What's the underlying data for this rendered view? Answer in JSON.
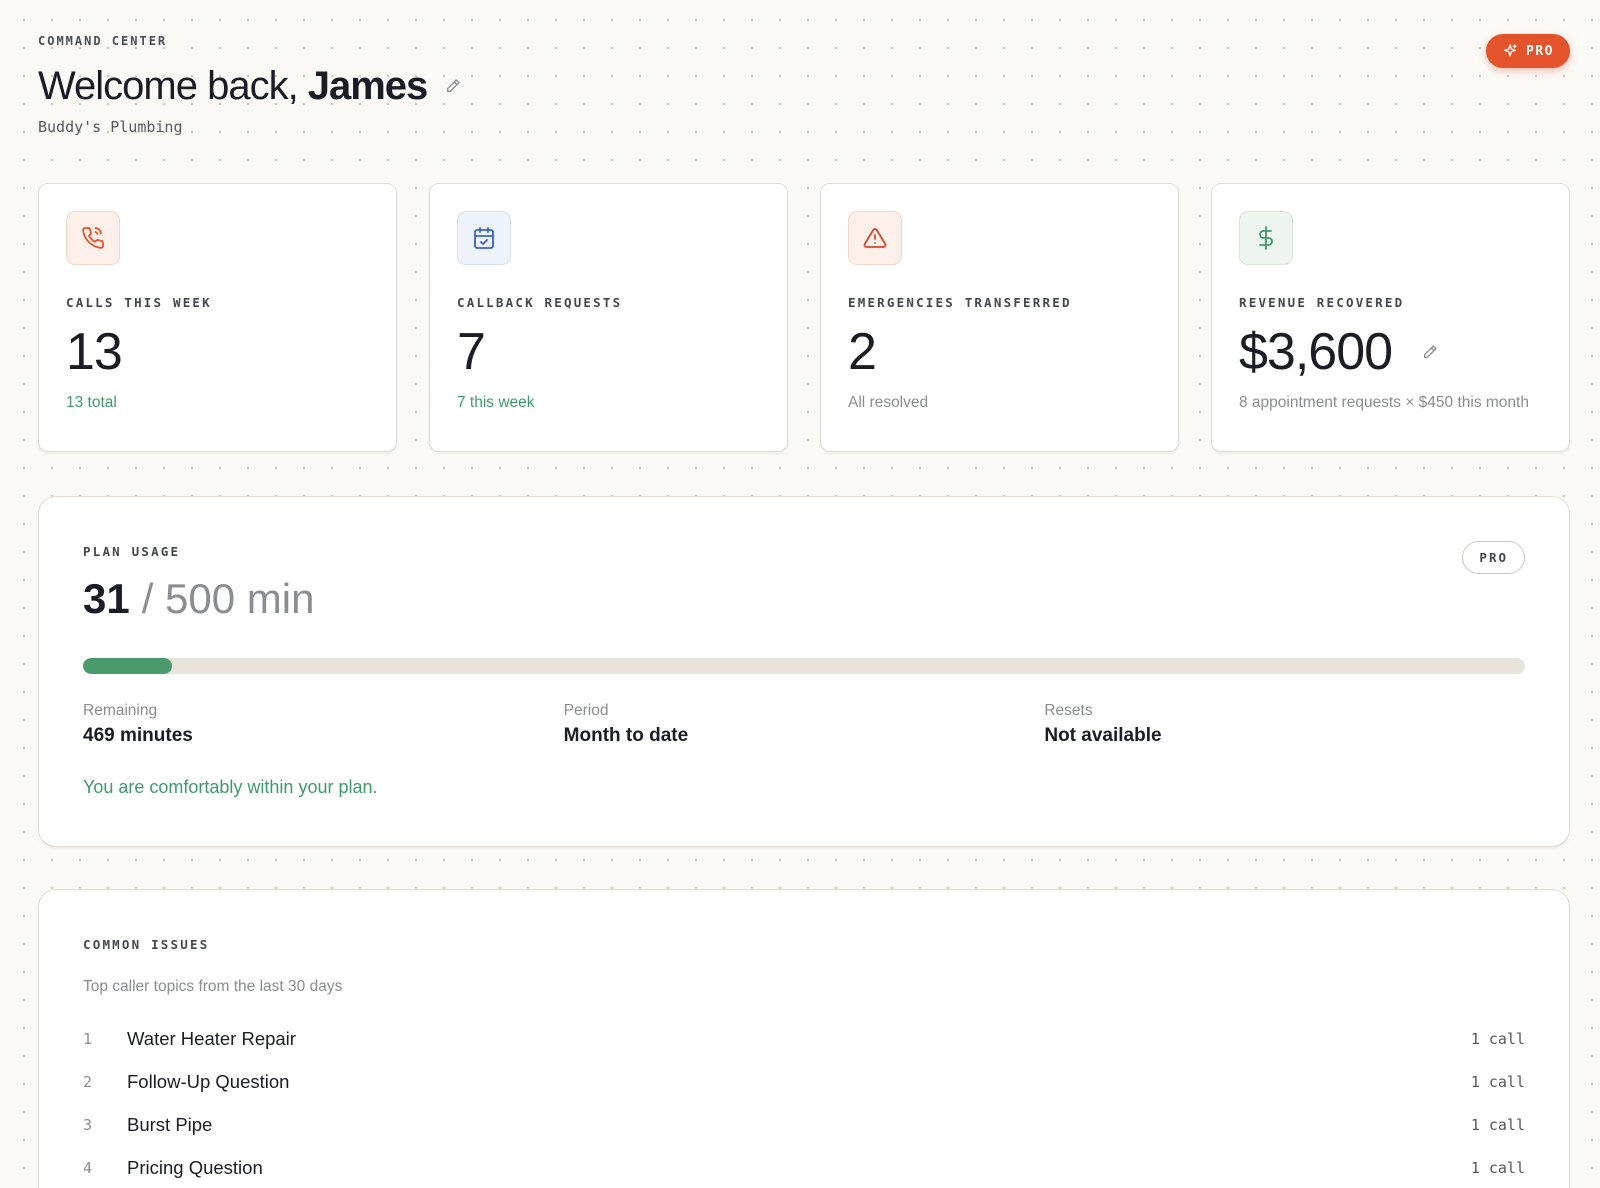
{
  "header": {
    "eyebrow": "COMMAND CENTER",
    "welcome_prefix": "Welcome back,",
    "user_name": "James",
    "company": "Buddy's Plumbing",
    "pro_button_label": "PRO"
  },
  "cards": [
    {
      "icon": "phone-icon",
      "label": "CALLS THIS WEEK",
      "value": "13",
      "sub": "13 total"
    },
    {
      "icon": "calendar-check-icon",
      "label": "CALLBACK REQUESTS",
      "value": "7",
      "sub": "7 this week"
    },
    {
      "icon": "alert-triangle-icon",
      "label": "EMERGENCIES TRANSFERRED",
      "value": "2",
      "sub": "All resolved"
    },
    {
      "icon": "dollar-icon",
      "label": "REVENUE RECOVERED",
      "value": "$3,600",
      "sub": "8 appointment requests × $450 this month"
    }
  ],
  "plan_usage": {
    "label": "PLAN USAGE",
    "tier": "PRO",
    "used": "31",
    "total_text": "/ 500 min",
    "progress_fraction": 0.062,
    "stats": [
      {
        "label": "Remaining",
        "value": "469 minutes"
      },
      {
        "label": "Period",
        "value": "Month to date"
      },
      {
        "label": "Resets",
        "value": "Not available"
      }
    ],
    "note": "You are comfortably within your plan."
  },
  "common_issues": {
    "label": "COMMON ISSUES",
    "subtitle": "Top caller topics from the last 30 days",
    "items": [
      {
        "rank": "1",
        "name": "Water Heater Repair",
        "count": "1 call"
      },
      {
        "rank": "2",
        "name": "Follow-Up Question",
        "count": "1 call"
      },
      {
        "rank": "3",
        "name": "Burst Pipe",
        "count": "1 call"
      },
      {
        "rank": "4",
        "name": "Pricing Question",
        "count": "1 call"
      }
    ]
  },
  "colors": {
    "accent": "#e5532a",
    "success": "#3f9a6b",
    "progress": "#4a9a6e",
    "track": "#e7e4dc"
  }
}
